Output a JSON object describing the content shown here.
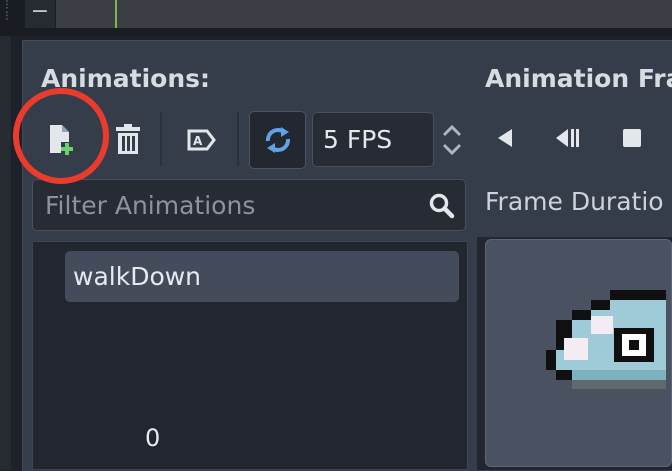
{
  "colors": {
    "background": "#1d2129",
    "panel": "#363d4a",
    "selected_item": "#444c5b",
    "accent_blue": "#5ea2e8",
    "add_green": "#6cd06c",
    "highlight_red": "#ea3c2c",
    "timeline_cursor": "#7cb742"
  },
  "top_bar": {
    "minus_label": "−"
  },
  "animations_panel": {
    "title": "Animations:",
    "toolbar": {
      "add_animation_icon": "file-add-icon",
      "delete_animation_icon": "trash-icon",
      "autoplay_icon": "autoplay-on-load-icon",
      "loop_icon": "loop-icon",
      "loop_enabled": true,
      "fps_value": "5 FPS"
    },
    "filter": {
      "placeholder": "Filter Animations",
      "icon": "search-icon"
    },
    "items": [
      {
        "label": "walkDown",
        "selected": true
      }
    ]
  },
  "frames_panel": {
    "title": "Animation Fra",
    "controls": [
      "play-backwards-icon",
      "step-backward-icon",
      "stop-icon"
    ],
    "frame_duration_label": "Frame Duratio",
    "frames": [
      {
        "index": "0"
      }
    ]
  }
}
